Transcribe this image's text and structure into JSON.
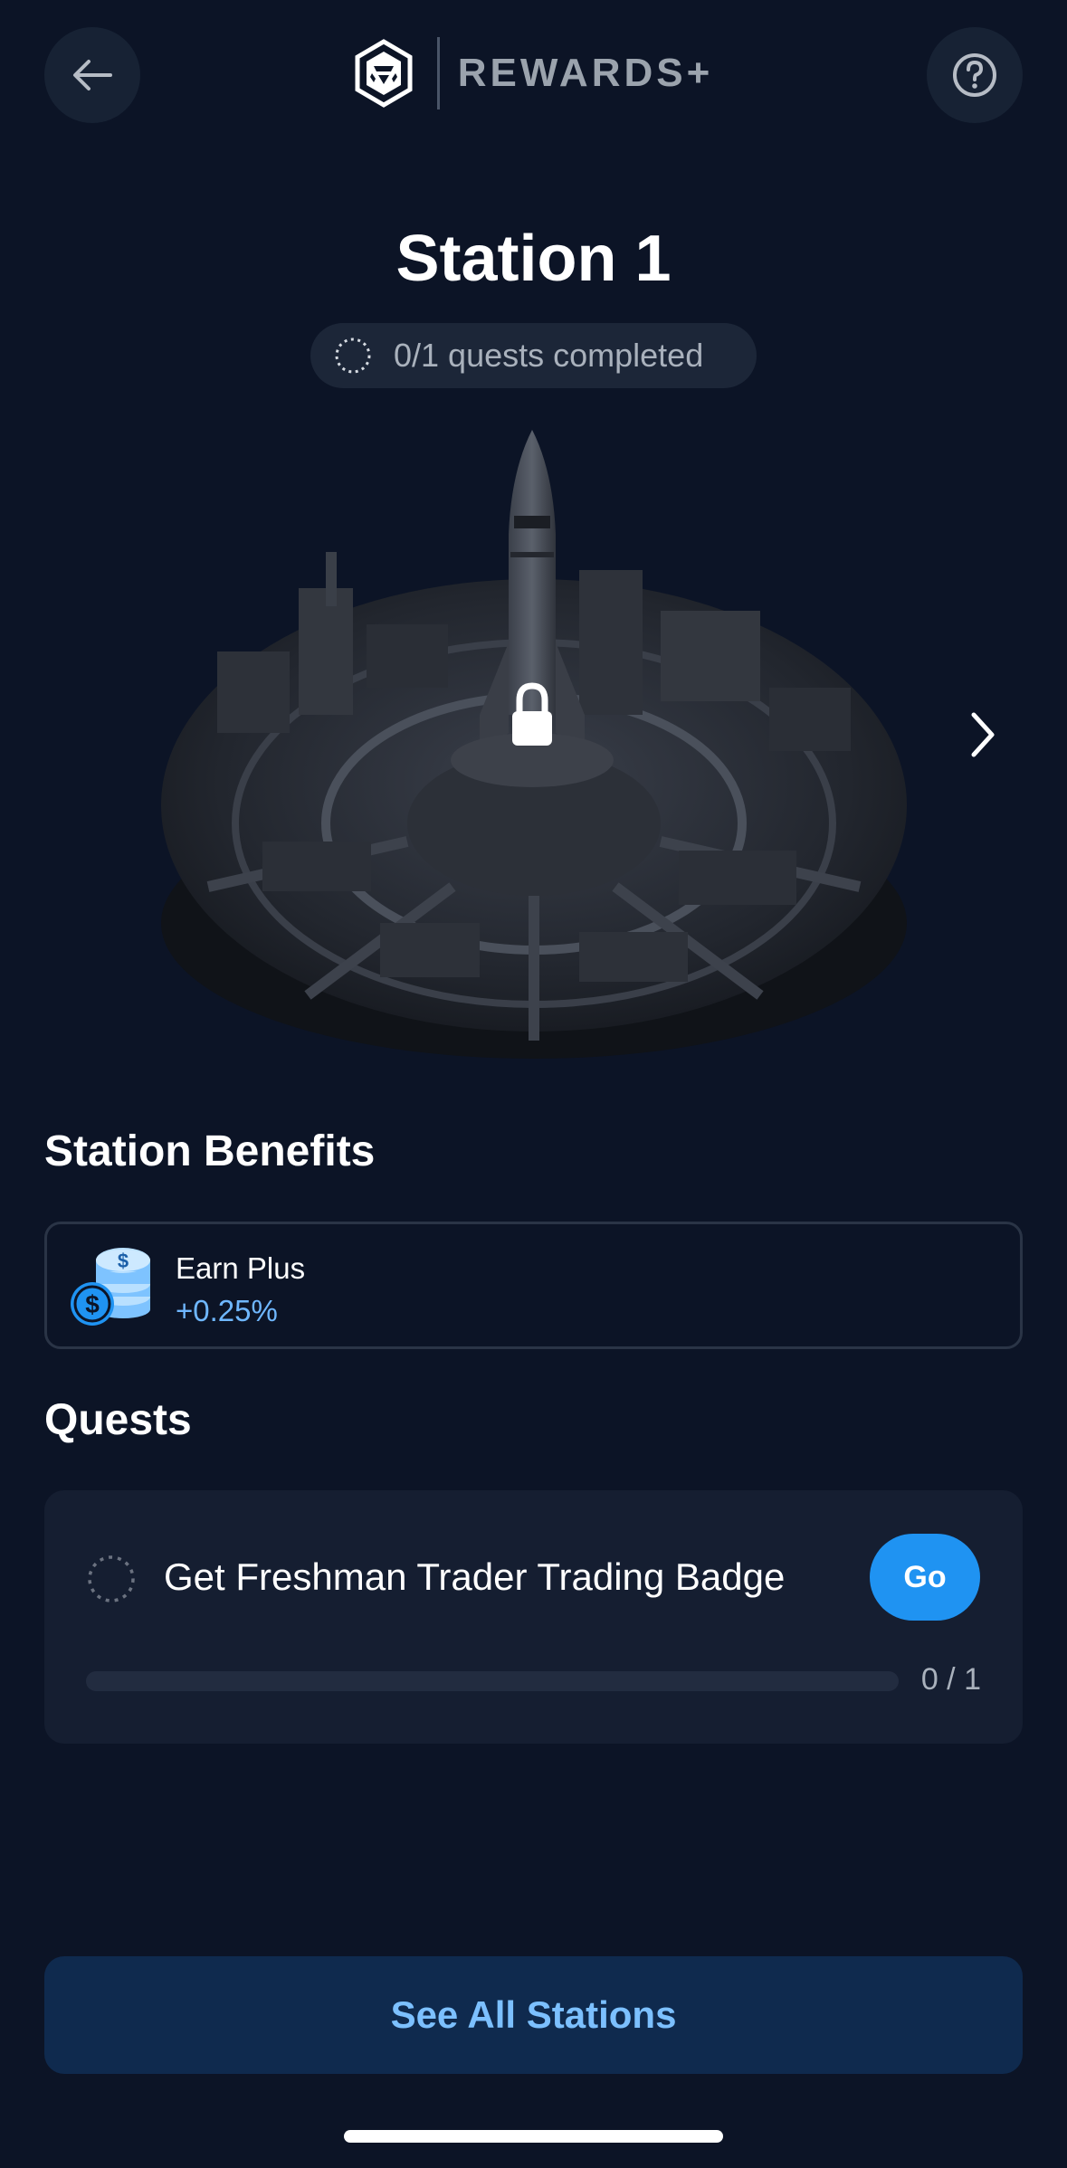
{
  "header": {
    "brand_text": "REWARDS+",
    "back_icon": "arrow-left-icon",
    "help_icon": "question-circle-icon",
    "logo_icon": "crypto-com-logo-icon"
  },
  "station": {
    "title": "Station 1",
    "quests_progress_text": "0/1 quests completed",
    "locked": true,
    "lock_icon": "lock-icon",
    "next_icon": "chevron-right-icon"
  },
  "benefits": {
    "heading": "Station Benefits",
    "items": [
      {
        "label": "Earn Plus",
        "value": "+0.25%",
        "icon": "coins-icon"
      }
    ]
  },
  "quests": {
    "heading": "Quests",
    "items": [
      {
        "label": "Get Freshman Trader Trading Badge",
        "button_label": "Go",
        "count_text": "0 / 1",
        "progress": 0
      }
    ]
  },
  "footer": {
    "see_all_label": "See All Stations"
  },
  "colors": {
    "background": "#0c1426",
    "accent": "#1f93f2",
    "benefit_value": "#6fb7ff",
    "see_all_bg": "#0f2a4e"
  }
}
